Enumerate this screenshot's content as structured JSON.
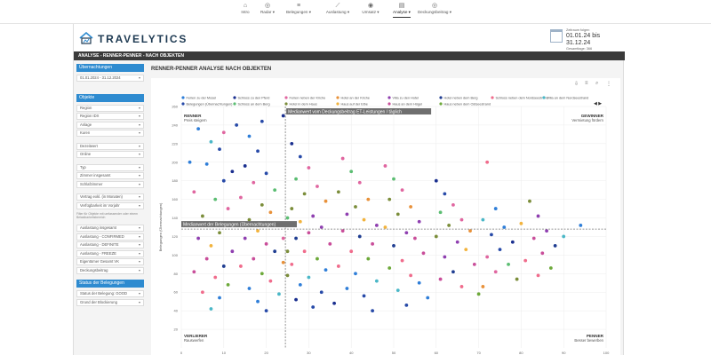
{
  "nav": {
    "items": [
      {
        "label": "Intro",
        "icon": "home-icon",
        "glyph": "⌂"
      },
      {
        "label": "Radar ▾",
        "icon": "radar-icon",
        "glyph": "◎"
      },
      {
        "label": "Belegungen ▾",
        "icon": "list-icon",
        "glyph": "≡"
      },
      {
        "label": "Auslastung ▾",
        "icon": "trend-icon",
        "glyph": "⟋"
      },
      {
        "label": "Umsatz ▾",
        "icon": "coin-icon",
        "glyph": "◉"
      },
      {
        "label": "Analyse ▾",
        "icon": "analysis-icon",
        "glyph": "▤"
      },
      {
        "label": "Deckungsbeitrag ▾",
        "icon": "target-icon",
        "glyph": "◎"
      }
    ]
  },
  "brand": {
    "name": "TRAVELYTICS"
  },
  "daterange": {
    "label": "Zeitraum folgen",
    "value": "01.01.24 bis 31.12.24",
    "sub": "Gesamttage: 366"
  },
  "page_title": "ANALYSE - RENNER-PENNER - NACH OBJEKTEN",
  "sidebar": {
    "head_overnights": "Übernachtungen",
    "date_value": "01.01.2024 - 31.12.2024",
    "head_objects": "Objekte",
    "filters1": [
      "Region",
      "Region IDX",
      "Anlage",
      "Kuren"
    ],
    "filters2": [
      "Dezeitwert",
      "Online"
    ],
    "filters3": [
      "Typ",
      "Zimmer insgesamt",
      "Schlafzimmer"
    ],
    "filters4": [
      "Vertrag exkl. (in Monaten)",
      "Verfügbarkeit im Vorjahr"
    ],
    "note": "Filter für Objekte mit umfassender oder einem Belastbarkeitsbereich",
    "filters5": [
      "Auslastung insgesamt",
      "Auslastung - CONFIRMED",
      "Auslastung - DEFINITE",
      "Auslastung - FREEZE",
      "Eigentümer Gesamt VK",
      "Deckungsbeitrag"
    ],
    "head_status": "Status der Belegungen",
    "filters6": [
      "Status der Belegung: GOOD",
      "Grund der Blockierung"
    ]
  },
  "chart_title": "RENNER-PENNER ANALYSE NACH OBJEKTEN",
  "chart_data": {
    "type": "scatter",
    "ylabel": "Belegungen (Übernachtungen)",
    "xlabel": "",
    "xlim": [
      0,
      100
    ],
    "ylim": [
      0,
      260
    ],
    "xticks": [
      0,
      10,
      20,
      30,
      40,
      50,
      60,
      70,
      80,
      90,
      100
    ],
    "yticks": [
      20,
      40,
      60,
      80,
      100,
      120,
      140,
      160,
      180,
      200,
      220,
      240,
      260
    ],
    "median_x": 24.5,
    "median_y": 128,
    "median_x_label": "Medianwert vom Deckungsbeitrag ET-Leistungen / täglich",
    "median_y_label": "Medianwert der Belegungen (Übernachtungen)",
    "quadrants": {
      "top_left": {
        "title": "RENNER",
        "sub": "Preis steigern"
      },
      "top_right": {
        "title": "GEWINNER",
        "sub": "Vermietung fördern"
      },
      "bottom_left": {
        "title": "VERLIERER",
        "sub": "Rauswerfen"
      },
      "bottom_right": {
        "title": "PENNER",
        "sub": "Besser bewerben"
      }
    },
    "legend": [
      {
        "name": "Ferien zu der Mosel",
        "color": "#2f7ed8"
      },
      {
        "name": "Schloss zu den Pferd",
        "color": "#1a2f8f"
      },
      {
        "name": "Ferien neben der Kirche",
        "color": "#e066a0"
      },
      {
        "name": "Hotel an der Kirche",
        "color": "#e8913a"
      },
      {
        "name": "Villa zu den Hotel",
        "color": "#8f3fb0"
      },
      {
        "name": "Hotel neben dem Berg",
        "color": "#1f3d91"
      },
      {
        "name": "Schloss neben dem Nordseestrand",
        "color": "#f06c8c"
      },
      {
        "name": "Villa an dem Nordseestrand",
        "color": "#4ab7c7"
      },
      {
        "name": "Belegungen (Übernachtungen)",
        "color": "#274aa8"
      },
      {
        "name": "Schloss an dem Berg",
        "color": "#5bbd72"
      },
      {
        "name": "Hotel in dem Haus",
        "color": "#7b8d3a"
      },
      {
        "name": "Haus auf der Elbe",
        "color": "#f2b33d"
      },
      {
        "name": "Haus an dem Hügel",
        "color": "#c94e9a"
      },
      {
        "name": "Haus neben dem Ostseestrand",
        "color": "#6da93a"
      }
    ],
    "series": [
      {
        "name": "points",
        "points": [
          [
            4,
            236
          ],
          [
            7,
            222
          ],
          [
            6,
            198
          ],
          [
            9,
            214
          ],
          [
            12,
            190
          ],
          [
            10,
            180
          ],
          [
            3,
            168
          ],
          [
            8,
            160
          ],
          [
            11,
            150
          ],
          [
            5,
            142
          ],
          [
            13,
            132
          ],
          [
            9,
            124
          ],
          [
            4,
            118
          ],
          [
            7,
            110
          ],
          [
            12,
            104
          ],
          [
            6,
            96
          ],
          [
            10,
            88
          ],
          [
            3,
            82
          ],
          [
            8,
            76
          ],
          [
            11,
            68
          ],
          [
            5,
            60
          ],
          [
            9,
            54
          ],
          [
            7,
            42
          ],
          [
            16,
            228
          ],
          [
            18,
            212
          ],
          [
            15,
            196
          ],
          [
            20,
            188
          ],
          [
            17,
            178
          ],
          [
            22,
            170
          ],
          [
            14,
            162
          ],
          [
            19,
            154
          ],
          [
            21,
            146
          ],
          [
            16,
            138
          ],
          [
            23,
            132
          ],
          [
            18,
            126
          ],
          [
            15,
            118
          ],
          [
            20,
            112
          ],
          [
            22,
            104
          ],
          [
            17,
            96
          ],
          [
            14,
            88
          ],
          [
            19,
            80
          ],
          [
            21,
            72
          ],
          [
            16,
            64
          ],
          [
            23,
            58
          ],
          [
            18,
            50
          ],
          [
            20,
            40
          ],
          [
            26,
            220
          ],
          [
            28,
            206
          ],
          [
            30,
            194
          ],
          [
            27,
            182
          ],
          [
            32,
            174
          ],
          [
            29,
            166
          ],
          [
            34,
            158
          ],
          [
            26,
            150
          ],
          [
            31,
            142
          ],
          [
            28,
            136
          ],
          [
            33,
            130
          ],
          [
            30,
            124
          ],
          [
            27,
            118
          ],
          [
            35,
            112
          ],
          [
            29,
            104
          ],
          [
            32,
            96
          ],
          [
            26,
            90
          ],
          [
            34,
            84
          ],
          [
            30,
            76
          ],
          [
            28,
            68
          ],
          [
            33,
            60
          ],
          [
            27,
            52
          ],
          [
            31,
            44
          ],
          [
            38,
            204
          ],
          [
            40,
            190
          ],
          [
            42,
            178
          ],
          [
            37,
            168
          ],
          [
            44,
            160
          ],
          [
            41,
            152
          ],
          [
            39,
            144
          ],
          [
            43,
            138
          ],
          [
            46,
            132
          ],
          [
            38,
            126
          ],
          [
            42,
            120
          ],
          [
            45,
            112
          ],
          [
            40,
            104
          ],
          [
            44,
            96
          ],
          [
            37,
            88
          ],
          [
            41,
            80
          ],
          [
            46,
            72
          ],
          [
            39,
            64
          ],
          [
            43,
            56
          ],
          [
            36,
            48
          ],
          [
            45,
            40
          ],
          [
            48,
            196
          ],
          [
            50,
            182
          ],
          [
            52,
            170
          ],
          [
            49,
            160
          ],
          [
            54,
            152
          ],
          [
            51,
            144
          ],
          [
            56,
            136
          ],
          [
            48,
            130
          ],
          [
            53,
            124
          ],
          [
            55,
            118
          ],
          [
            50,
            110
          ],
          [
            57,
            102
          ],
          [
            52,
            94
          ],
          [
            49,
            86
          ],
          [
            54,
            78
          ],
          [
            56,
            70
          ],
          [
            51,
            62
          ],
          [
            58,
            54
          ],
          [
            53,
            46
          ],
          [
            60,
            180
          ],
          [
            62,
            166
          ],
          [
            64,
            154
          ],
          [
            61,
            146
          ],
          [
            66,
            138
          ],
          [
            63,
            132
          ],
          [
            68,
            126
          ],
          [
            60,
            120
          ],
          [
            65,
            114
          ],
          [
            67,
            106
          ],
          [
            62,
            98
          ],
          [
            69,
            90
          ],
          [
            64,
            82
          ],
          [
            61,
            74
          ],
          [
            66,
            66
          ],
          [
            70,
            58
          ],
          [
            72,
            200
          ],
          [
            74,
            150
          ],
          [
            71,
            138
          ],
          [
            76,
            130
          ],
          [
            73,
            122
          ],
          [
            78,
            114
          ],
          [
            75,
            106
          ],
          [
            72,
            98
          ],
          [
            77,
            90
          ],
          [
            74,
            82
          ],
          [
            79,
            74
          ],
          [
            71,
            66
          ],
          [
            82,
            158
          ],
          [
            84,
            142
          ],
          [
            80,
            134
          ],
          [
            86,
            126
          ],
          [
            83,
            118
          ],
          [
            88,
            110
          ],
          [
            85,
            102
          ],
          [
            81,
            94
          ],
          [
            87,
            86
          ],
          [
            84,
            78
          ],
          [
            94,
            132
          ],
          [
            90,
            120
          ],
          [
            2,
            200
          ],
          [
            13,
            240
          ],
          [
            24,
            250
          ],
          [
            19,
            244
          ],
          [
            10,
            232
          ],
          [
            25,
            140
          ],
          [
            24,
            118
          ],
          [
            25,
            104
          ],
          [
            24,
            92
          ],
          [
            25,
            78
          ]
        ]
      }
    ]
  }
}
